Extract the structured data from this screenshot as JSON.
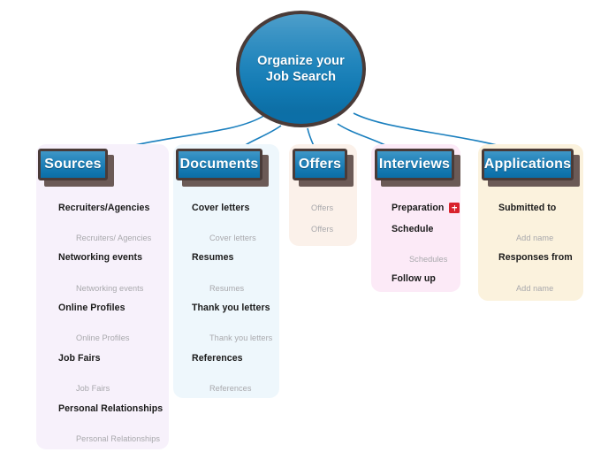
{
  "root": {
    "label": "Organize your\nJob Search",
    "line1": "Organize your",
    "line2": "Job Search",
    "fill_top": "#4e9fcb",
    "fill_bottom": "#0b6fa8",
    "border": "#4a3b38"
  },
  "theme": {
    "chip_gradient_top": "#3f97c6",
    "chip_gradient_bottom": "#0c6ea6",
    "chip_border": "#4a3b38",
    "chip_shadow": "#6b5a56",
    "connector_main": "#1a7fbe",
    "connector_branch": "#7fb6d6",
    "topic_text": "#1a1a1a",
    "subtopic_text": "#a8a8ac",
    "badge_red": "#d8222c"
  },
  "columns": [
    {
      "id": "sources",
      "title": "Sources",
      "background": "#f7f1fb",
      "topics": [
        {
          "label": "Recruiters/Agencies",
          "sub": "Recruiters/ Agencies",
          "badge": null
        },
        {
          "label": "Networking events",
          "sub": "Networking events",
          "badge": null
        },
        {
          "label": "Online Profiles",
          "sub": "Online Profiles",
          "badge": null
        },
        {
          "label": "Job Fairs",
          "sub": "Job Fairs",
          "badge": null
        },
        {
          "label": "Personal Relationships",
          "sub": "Personal Relationships",
          "badge": null
        }
      ]
    },
    {
      "id": "documents",
      "title": "Documents",
      "background": "#eef7fc",
      "topics": [
        {
          "label": "Cover letters",
          "sub": "Cover letters",
          "badge": null
        },
        {
          "label": "Resumes",
          "sub": "Resumes",
          "badge": null
        },
        {
          "label": "Thank you letters",
          "sub": "Thank you letters",
          "badge": null
        },
        {
          "label": "References",
          "sub": "References",
          "badge": null
        }
      ]
    },
    {
      "id": "offers",
      "title": "Offers",
      "background": "#fbf1ea",
      "topics": [
        {
          "label": "Offers",
          "sub": null,
          "badge": null,
          "muted": true
        },
        {
          "label": "Offers",
          "sub": null,
          "badge": null,
          "muted": true
        }
      ]
    },
    {
      "id": "interviews",
      "title": "Interviews",
      "background": "#fceaf7",
      "topics": [
        {
          "label": "Preparation",
          "sub": null,
          "badge": "attachment-badge"
        },
        {
          "label": "Schedule",
          "sub": "Schedules",
          "badge": null
        },
        {
          "label": "Follow up",
          "sub": null,
          "badge": null
        }
      ]
    },
    {
      "id": "applications",
      "title": "Applications",
      "background": "#fbf2dd",
      "topics": [
        {
          "label": "Submitted to",
          "sub": "Add name",
          "badge": null
        },
        {
          "label": "Responses from",
          "sub": "Add name",
          "badge": null
        }
      ]
    }
  ]
}
